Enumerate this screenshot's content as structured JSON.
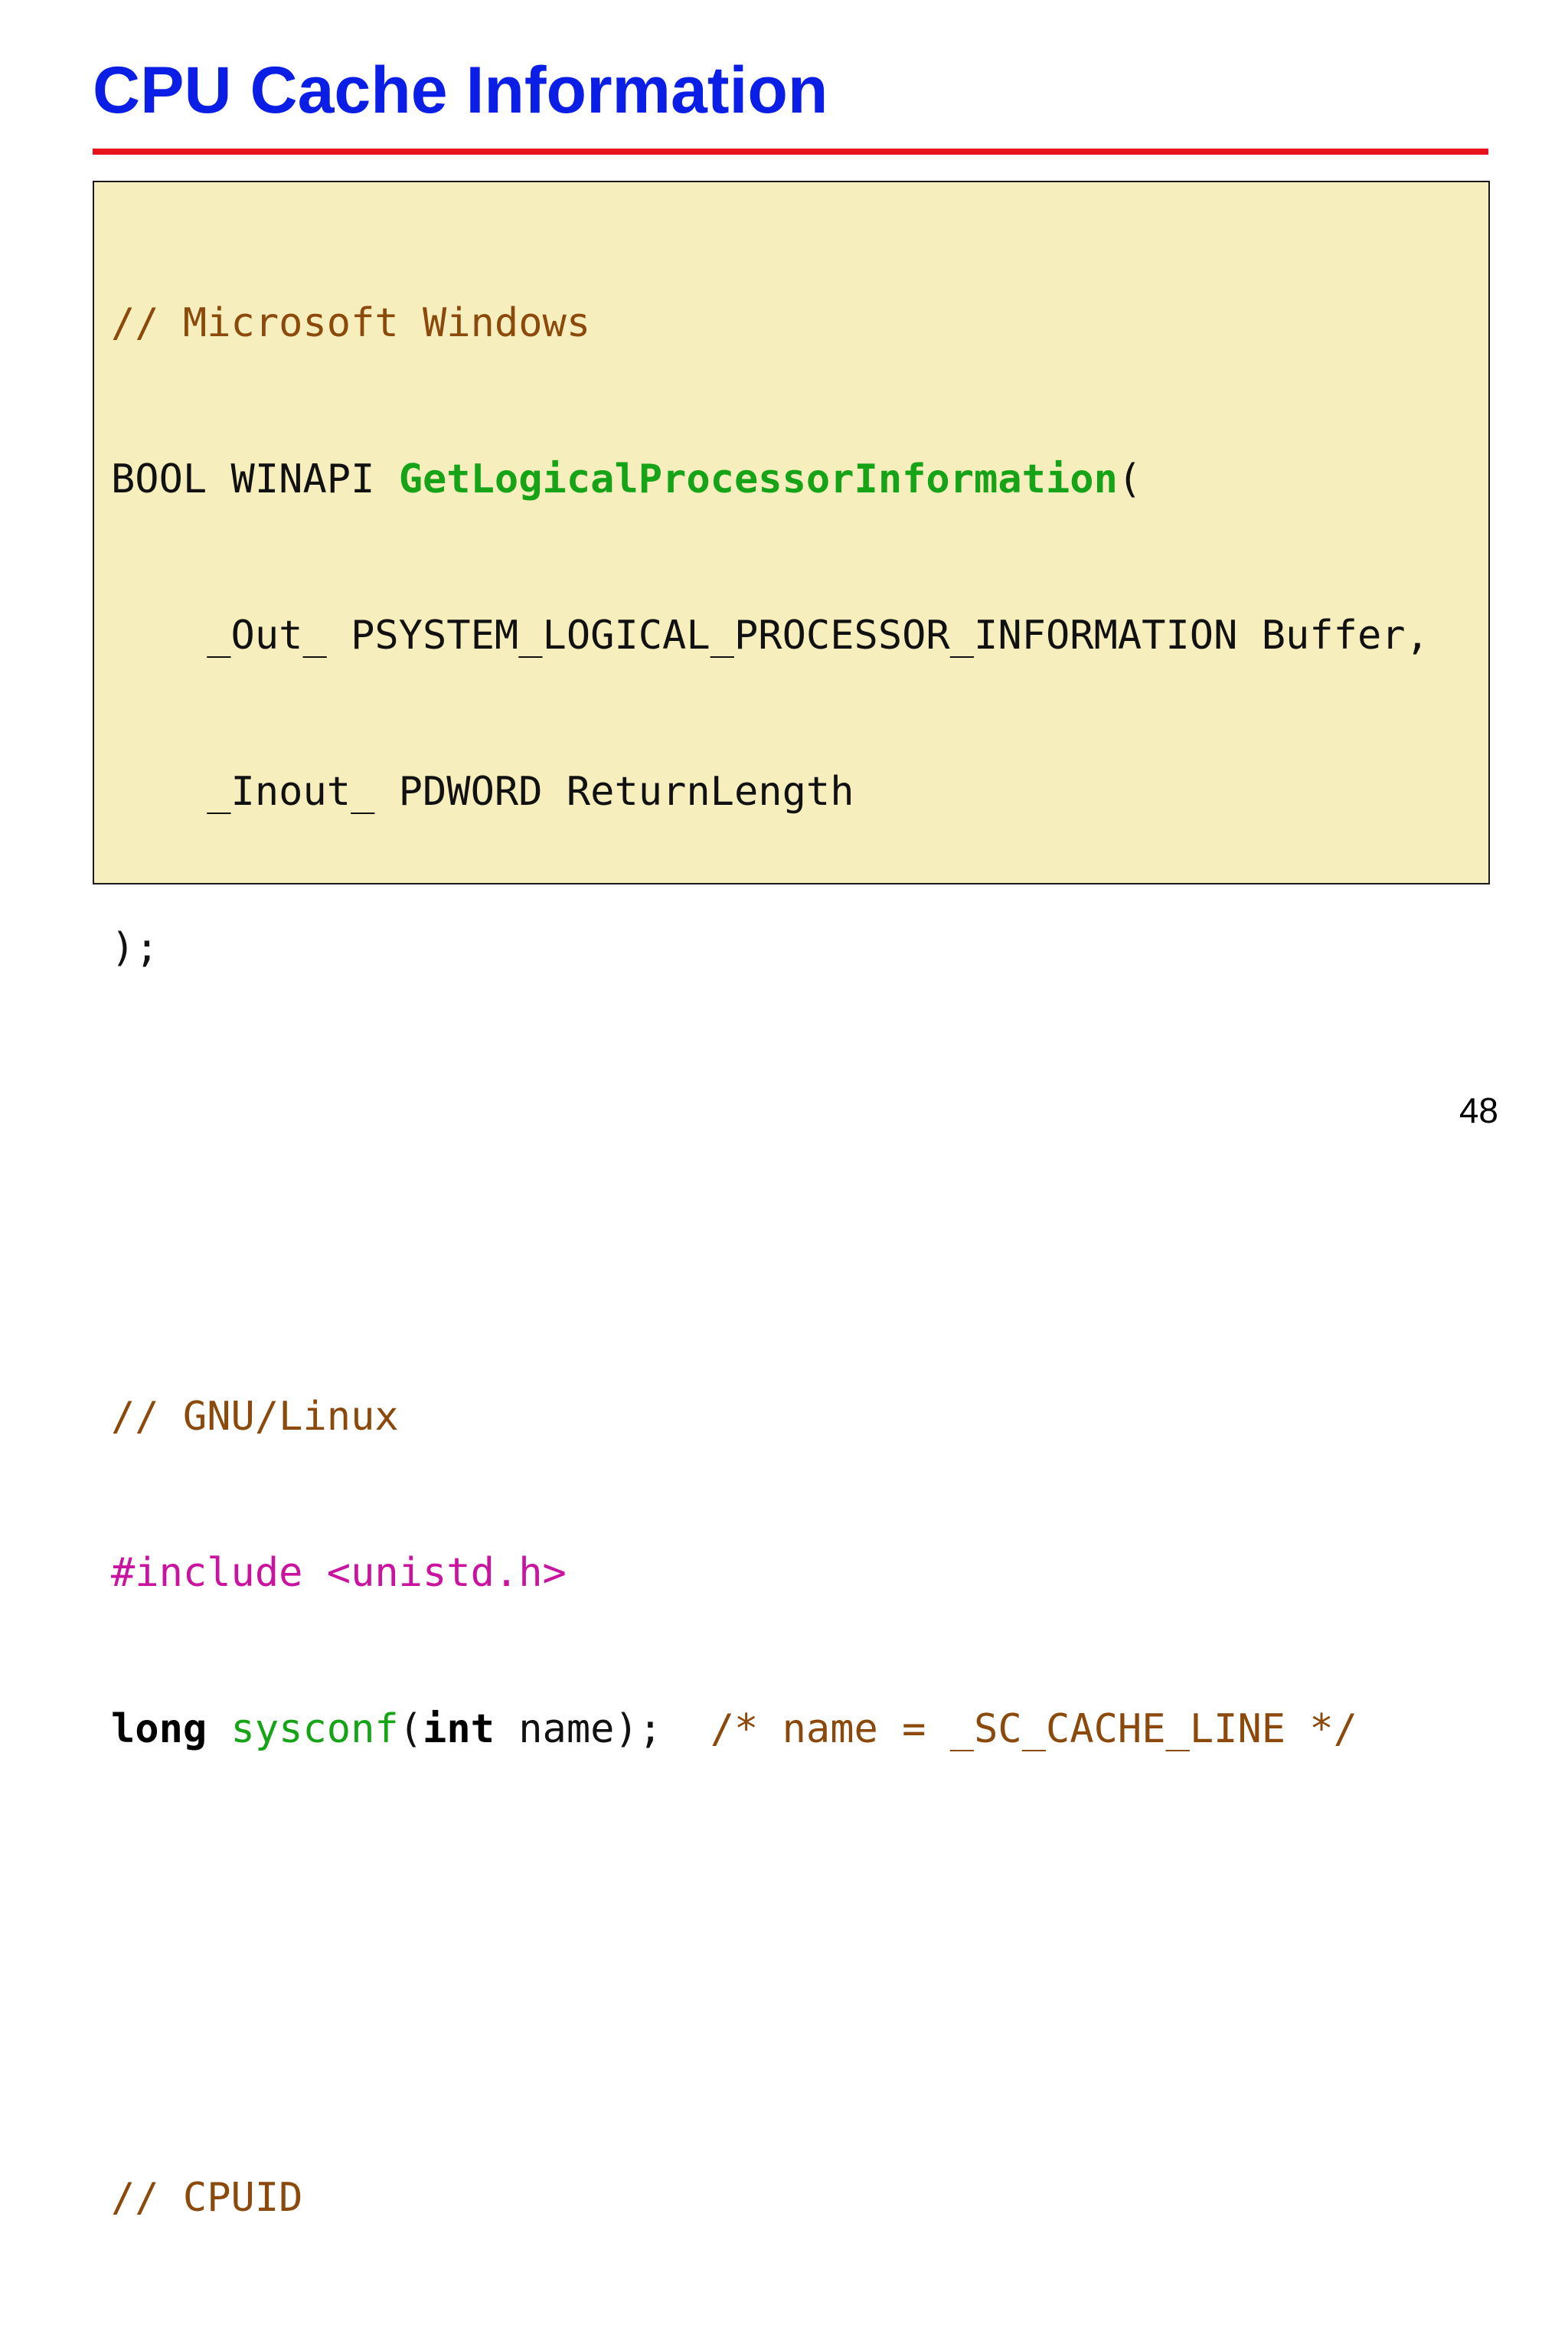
{
  "slide": {
    "title": "CPU Cache Information",
    "page_number": "48"
  },
  "code": {
    "windows_comment": "// Microsoft Windows",
    "windows_ret": "BOOL WINAPI ",
    "windows_fn": "GetLogicalProcessorInformation",
    "windows_open": "(",
    "windows_param1": "    _Out_ PSYSTEM_LOGICAL_PROCESSOR_INFORMATION Buffer,",
    "windows_param2": "    _Inout_ PDWORD ReturnLength",
    "windows_close": ");",
    "linux_comment": "// GNU/Linux",
    "linux_include": "#include <unistd.h>",
    "linux_ret_kw": "long",
    "linux_fn": "sysconf",
    "linux_paren_open": "(",
    "linux_param_kw": "int",
    "linux_rest": " name);  ",
    "linux_trailing_comment": "/* name = _SC_CACHE_LINE */",
    "cpuid_comment": "// CPUID"
  },
  "colors": {
    "title": "#0a1ee6",
    "rule": "#e8121c",
    "code_background": "#f7eebd",
    "comment": "#8b4a0c",
    "function": "#17a317",
    "preprocessor": "#c8149e"
  }
}
